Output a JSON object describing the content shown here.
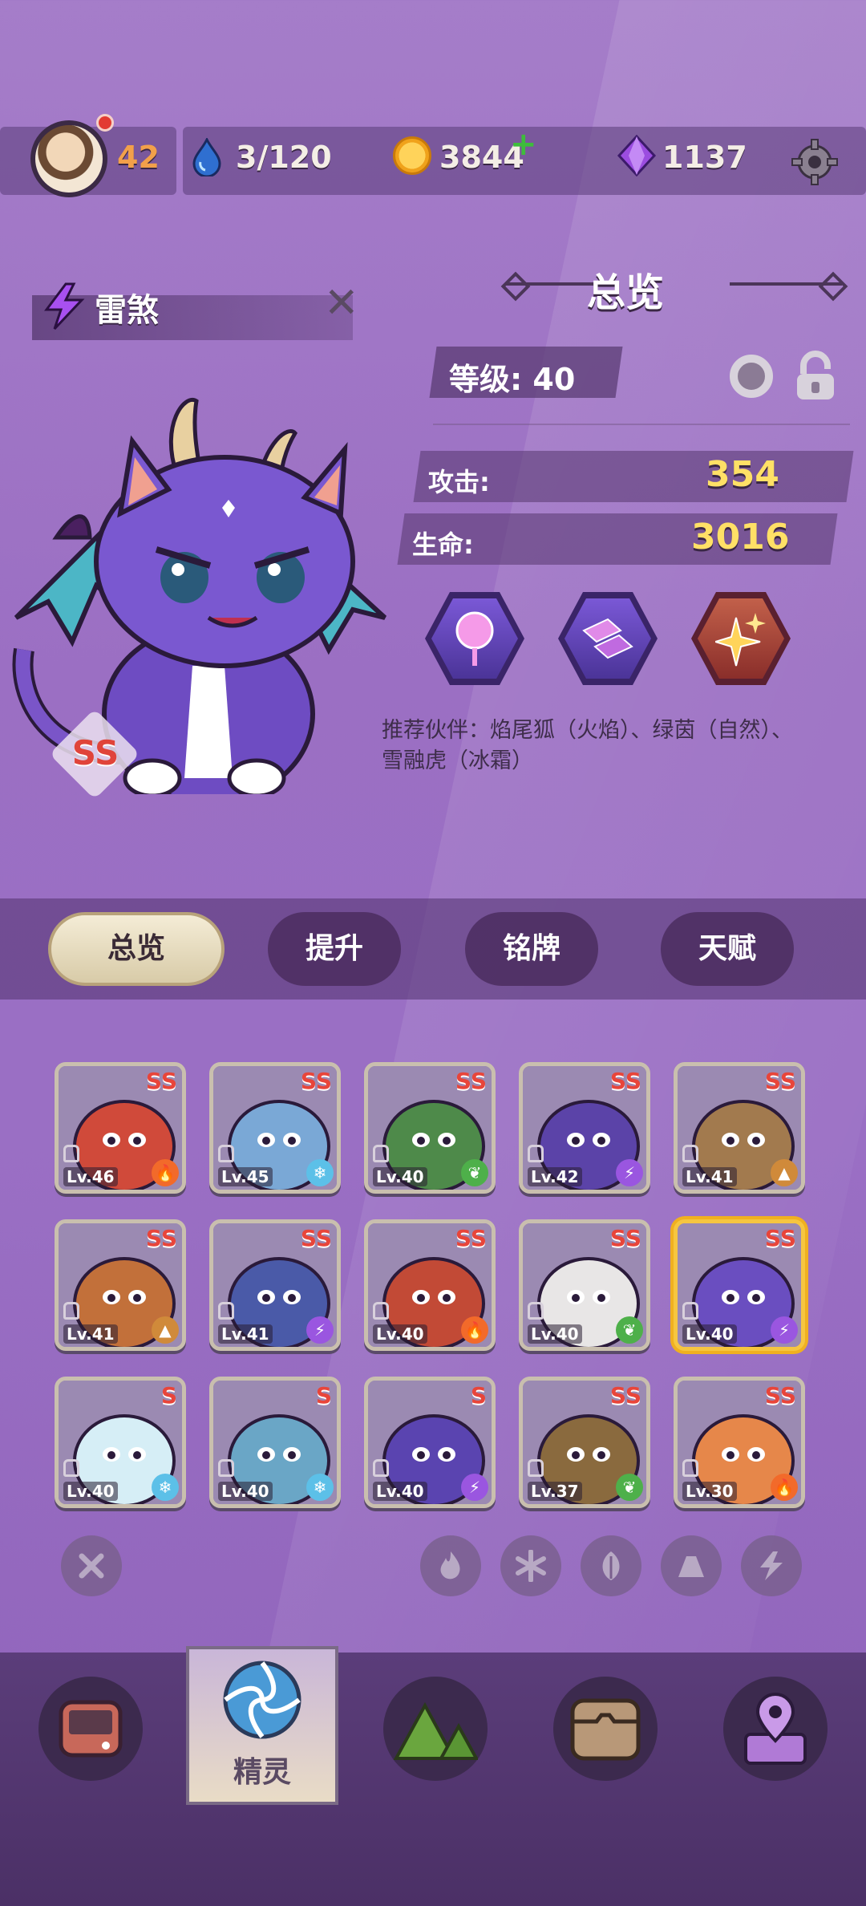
{
  "topbar": {
    "player_level": "42",
    "stamina": "3/120",
    "coins": "3844",
    "gems": "1137"
  },
  "pet": {
    "name": "雷煞",
    "rank": "SS"
  },
  "overview": {
    "title": "总览",
    "level": "等级: 40",
    "attack_label": "攻击:",
    "attack_value": "354",
    "hp_label": "生命:",
    "hp_value": "3016",
    "recommend": "推荐伙伴：焰尾狐（火焰）、绿茵（自然）、雪融虎（冰霜）"
  },
  "tabs": [
    "总览",
    "提升",
    "铭牌",
    "天赋"
  ],
  "grid": [
    {
      "rank": "SS",
      "level": "Lv.46",
      "element": "fire",
      "color": "#d04a3a"
    },
    {
      "rank": "SS",
      "level": "Lv.45",
      "element": "ice",
      "color": "#7aa8d6"
    },
    {
      "rank": "SS",
      "level": "Lv.40",
      "element": "nature",
      "color": "#4e8a4a"
    },
    {
      "rank": "SS",
      "level": "Lv.42",
      "element": "thunder",
      "color": "#5b43a8"
    },
    {
      "rank": "SS",
      "level": "Lv.41",
      "element": "earth",
      "color": "#a27a4e"
    },
    {
      "rank": "SS",
      "level": "Lv.41",
      "element": "earth",
      "color": "#c2703a"
    },
    {
      "rank": "SS",
      "level": "Lv.41",
      "element": "thunder",
      "color": "#4a5aa8"
    },
    {
      "rank": "SS",
      "level": "Lv.40",
      "element": "fire",
      "color": "#c24a36"
    },
    {
      "rank": "SS",
      "level": "Lv.40",
      "element": "nature",
      "color": "#e8e6e6"
    },
    {
      "rank": "SS",
      "level": "Lv.40",
      "element": "thunder",
      "color": "#6a4ec0"
    },
    {
      "rank": "S",
      "level": "Lv.40",
      "element": "ice",
      "color": "#d6eef6"
    },
    {
      "rank": "S",
      "level": "Lv.40",
      "element": "ice",
      "color": "#6aa6c6"
    },
    {
      "rank": "S",
      "level": "Lv.40",
      "element": "thunder",
      "color": "#5a44b0"
    },
    {
      "rank": "SS",
      "level": "Lv.37",
      "element": "nature",
      "color": "#8a6a3e"
    },
    {
      "rank": "SS",
      "level": "Lv.30",
      "element": "fire",
      "color": "#e6874a"
    }
  ],
  "nav": {
    "active_label": "精灵"
  },
  "colors": {
    "fire": "#f26a2a",
    "ice": "#5cc0e8",
    "nature": "#4eb04a",
    "thunder": "#9a56e0",
    "earth": "#d08a3a"
  }
}
